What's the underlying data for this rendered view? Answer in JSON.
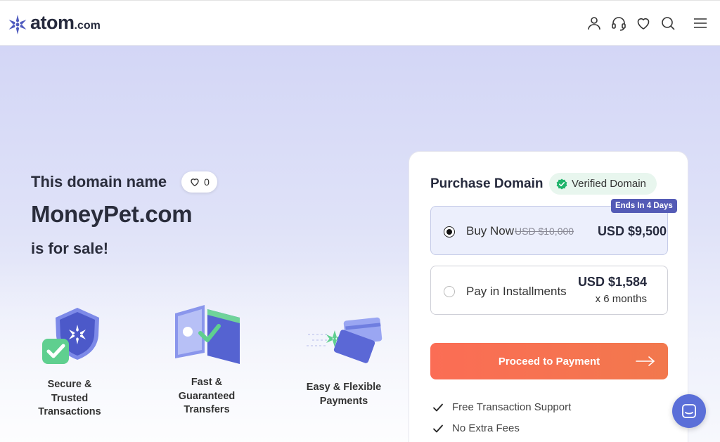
{
  "header": {
    "brand_main": "atom",
    "brand_tld": ".com",
    "icons": [
      "user-icon",
      "headset-icon",
      "heart-icon",
      "search-icon",
      "menu-icon"
    ]
  },
  "hero": {
    "line1": "This domain name",
    "like_count": "0",
    "domain": "MoneyPet.com",
    "line3": "is for sale!"
  },
  "features": [
    {
      "label_lines": [
        "Secure &",
        "Trusted",
        "Transactions"
      ],
      "icon": "shield-check-icon"
    },
    {
      "label_lines": [
        "Fast &",
        "Guaranteed",
        "Transfers"
      ],
      "icon": "transfer-icon"
    },
    {
      "label_lines": [
        "Easy & Flexible",
        "Payments"
      ],
      "icon": "cards-icon"
    }
  ],
  "purchase": {
    "title": "Purchase Domain",
    "verified_label": "Verified Domain",
    "badge": "Ends In 4 Days",
    "options": [
      {
        "label": "Buy Now",
        "old_price": "USD $10,000",
        "price": "USD $9,500",
        "selected": true
      },
      {
        "label": "Pay in Installments",
        "price": "USD $1,584",
        "term": "x 6 months",
        "selected": false
      }
    ],
    "cta": "Proceed to Payment",
    "perks": [
      "Free Transaction Support",
      "No Extra Fees"
    ]
  },
  "colors": {
    "accent_cta": "#fb6d55",
    "badge": "#545bb6",
    "verified_green": "#1fb36b",
    "chat": "#5b6fd8"
  }
}
